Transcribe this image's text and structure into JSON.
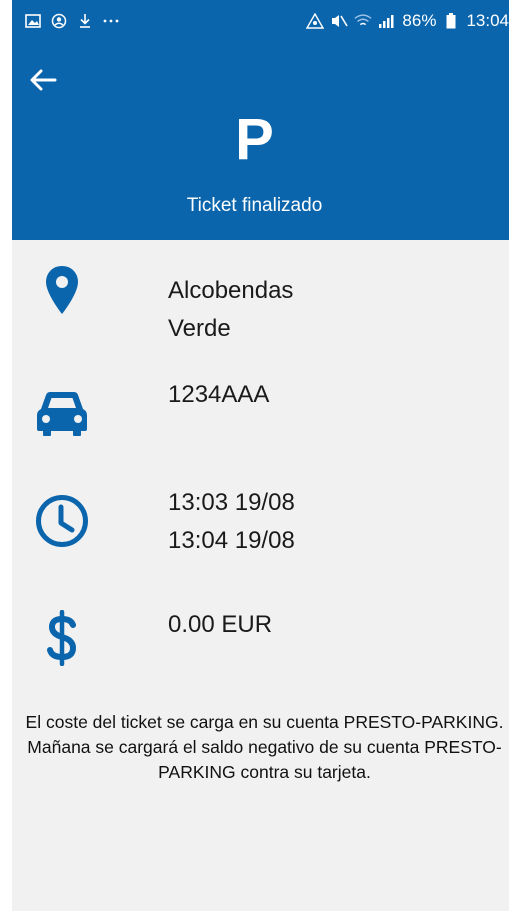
{
  "status_bar": {
    "signal_pct": "86%",
    "time": "13:04"
  },
  "header": {
    "logo": "P",
    "title": "Ticket finalizado",
    "background": "#0a65ad"
  },
  "details": {
    "location_line1": "Alcobendas",
    "location_line2": "Verde",
    "plate": "1234AAA",
    "start_time": "13:03 19/08",
    "end_time": "13:04 19/08",
    "price": "0.00 EUR"
  },
  "note": "El coste del ticket se carga en su cuenta PRESTO-PARKING. Mañana se cargará el saldo negativo de su cuenta PRESTO-PARKING contra su tarjeta.",
  "icons": {
    "location": "map-pin-icon",
    "vehicle": "car-icon",
    "time": "clock-icon",
    "price": "dollar-icon",
    "back": "arrow-left-icon"
  },
  "colors": {
    "accent": "#0a65ad",
    "background": "#f1f1f1"
  }
}
